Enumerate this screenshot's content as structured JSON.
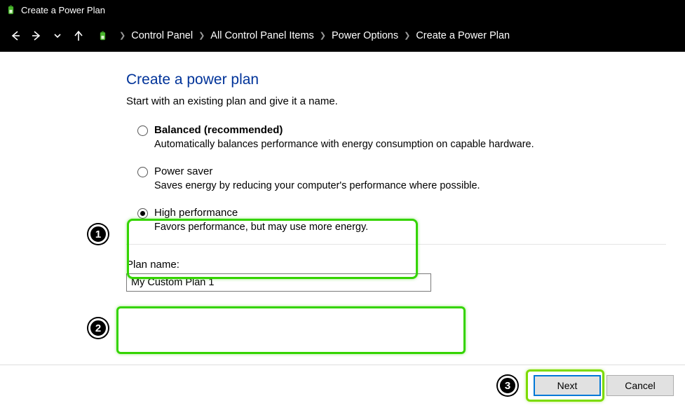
{
  "window": {
    "title": "Create a Power Plan"
  },
  "breadcrumb": {
    "items": [
      "Control Panel",
      "All Control Panel Items",
      "Power Options",
      "Create a Power Plan"
    ]
  },
  "page": {
    "title": "Create a power plan",
    "subtitle": "Start with an existing plan and give it a name."
  },
  "plans": [
    {
      "label": "Balanced (recommended)",
      "desc": "Automatically balances performance with energy consumption on capable hardware.",
      "bold": true,
      "selected": false
    },
    {
      "label": "Power saver",
      "desc": "Saves energy by reducing your computer's performance where possible.",
      "bold": false,
      "selected": false
    },
    {
      "label": "High performance",
      "desc": "Favors performance, but may use more energy.",
      "bold": false,
      "selected": true
    }
  ],
  "plan_name": {
    "label": "Plan name:",
    "value": "My Custom Plan 1"
  },
  "buttons": {
    "next": "Next",
    "cancel": "Cancel"
  },
  "steps": {
    "s1": "1",
    "s2": "2",
    "s3": "3"
  }
}
